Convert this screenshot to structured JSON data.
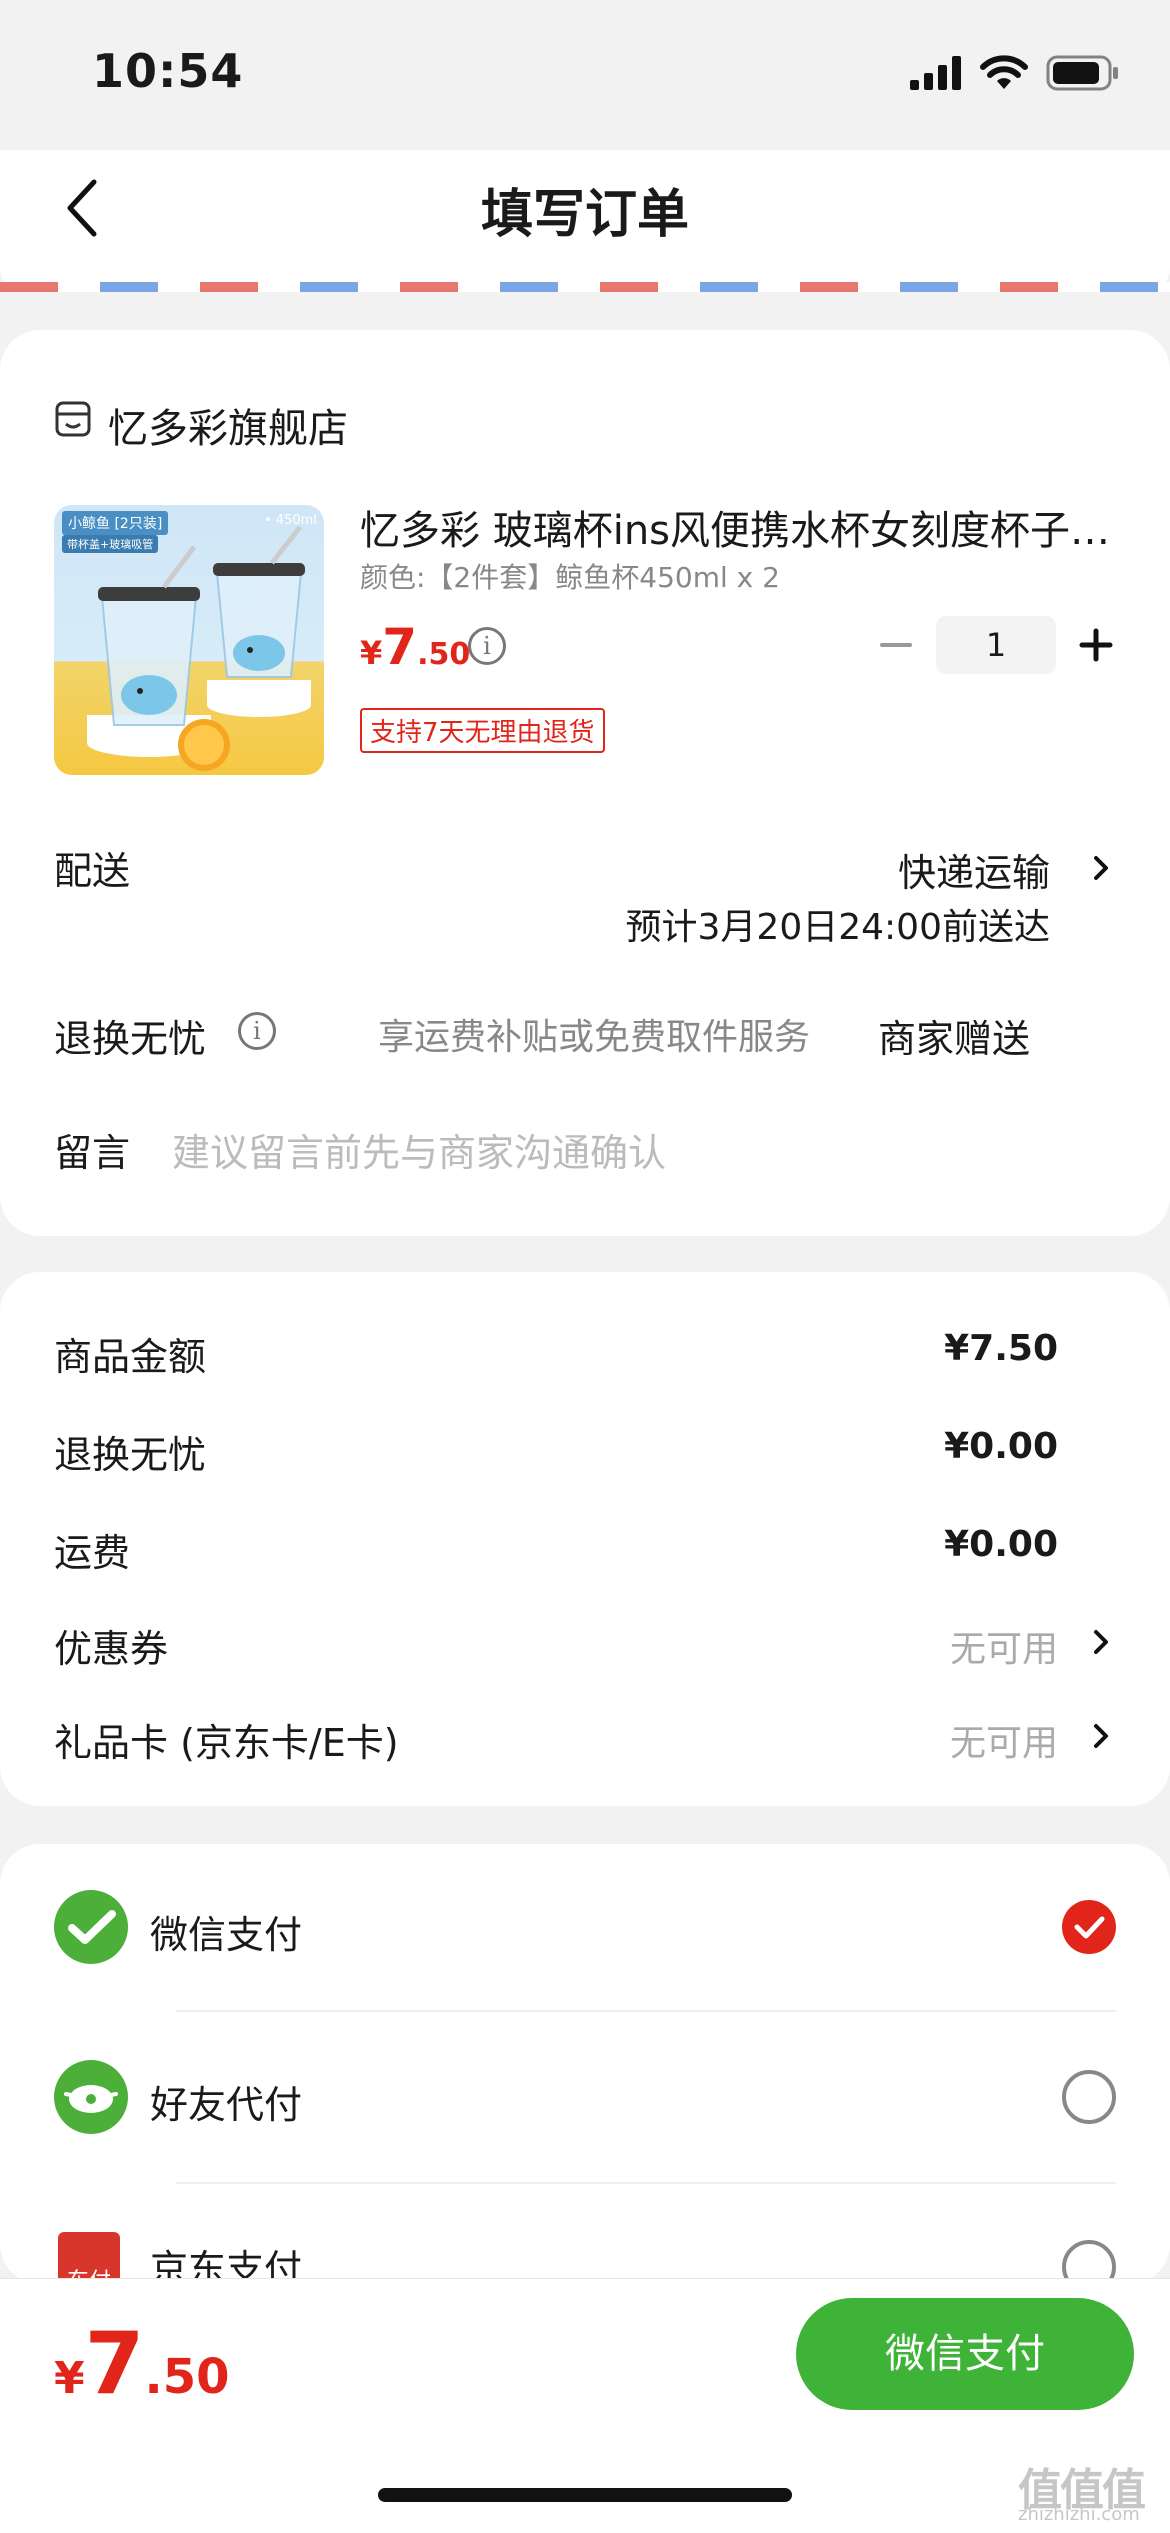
{
  "status_bar": {
    "time": "10:54"
  },
  "nav": {
    "title": "填写订单"
  },
  "shop": {
    "name": "忆多彩旗舰店",
    "product": {
      "image_label": "小鲸鱼 [2只装]",
      "image_capacity": "• 450ml",
      "image_tag": "带杯盖+玻璃吸管",
      "title": "忆多彩 玻璃杯ins风便携水杯女刻度杯子…",
      "spec": "颜色:【2件套】鲸鱼杯450ml x 2",
      "price_symbol": "¥",
      "price_int": "7",
      "price_dec": ".50",
      "quantity": "1",
      "return_badge": "支持7天无理由退货"
    },
    "delivery": {
      "label": "配送",
      "method": "快递运输",
      "eta": "预计3月20日24:00前送达"
    },
    "return_worry": {
      "label": "退换无忧",
      "desc": "享运费补贴或免费取件服务",
      "value": "商家赠送"
    },
    "message": {
      "label": "留言",
      "placeholder": "建议留言前先与商家沟通确认"
    }
  },
  "summary": {
    "goods_label": "商品金额",
    "goods_value": "¥7.50",
    "return_label": "退换无忧",
    "return_value": "¥0.00",
    "freight_label": "运费",
    "freight_value": "¥0.00",
    "coupon_label": "优惠券",
    "coupon_value": "无可用",
    "giftcard_label": "礼品卡 (京东卡/E卡)",
    "giftcard_value": "无可用"
  },
  "payment": {
    "methods": [
      {
        "label": "微信支付",
        "selected": true
      },
      {
        "label": "好友代付",
        "selected": false
      },
      {
        "label": "京东支付",
        "selected": false
      }
    ],
    "jd_icon_text": "东付"
  },
  "bottom": {
    "price_symbol": "¥",
    "price_int": "7",
    "price_dec": ".50",
    "pay_button": "微信支付"
  },
  "watermark": {
    "main": "值值值",
    "sub": "zhizhizhi.com"
  },
  "colors": {
    "accent_red": "#e1251b",
    "wechat_green": "#3fb338"
  }
}
